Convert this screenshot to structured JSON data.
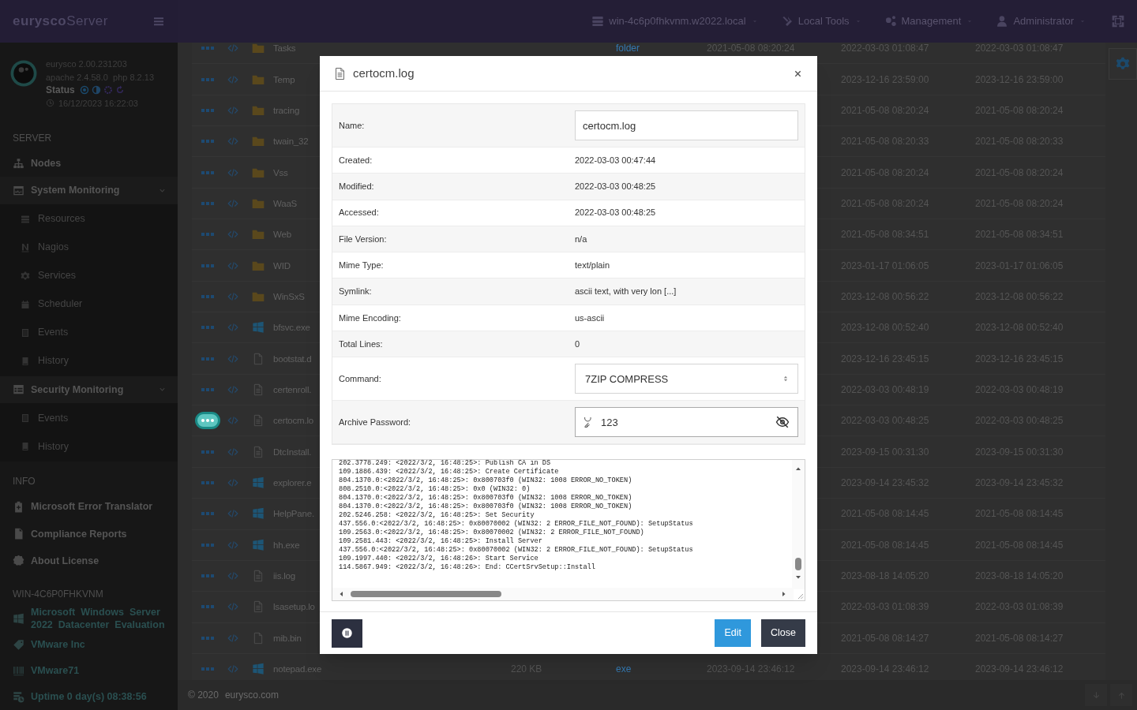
{
  "topbar": {
    "brand_bold": "eurysco",
    "brand_light": "Server",
    "menus": [
      {
        "label": "win-4c6p0fhkvnm.w2022.local"
      },
      {
        "label": "Local Tools"
      },
      {
        "label": "Management"
      },
      {
        "label": "Administrator"
      }
    ]
  },
  "sidebar": {
    "profile": {
      "version": "eurysco 2.00.231203",
      "stack": "apache 2.4.58.0  php 8.2.13",
      "status_label": "Status",
      "datetime": "16/12/2023 16:22:03"
    },
    "sections": [
      {
        "heading": "SERVER",
        "items": [
          {
            "label": "Nodes",
            "kind": "link"
          },
          {
            "label": "System Monitoring",
            "kind": "group",
            "expanded": true,
            "children": [
              {
                "label": "Resources"
              },
              {
                "label": "Nagios"
              },
              {
                "label": "Services"
              },
              {
                "label": "Scheduler"
              },
              {
                "label": "Events"
              },
              {
                "label": "History"
              }
            ]
          },
          {
            "label": "Security Monitoring",
            "kind": "group",
            "expanded": true,
            "children": [
              {
                "label": "Events"
              },
              {
                "label": "History"
              }
            ]
          }
        ]
      },
      {
        "heading": "INFO",
        "items": [
          {
            "label": "Microsoft Error Translator",
            "kind": "link"
          },
          {
            "label": "Compliance Reports",
            "kind": "link"
          },
          {
            "label": "About License",
            "kind": "link"
          }
        ]
      },
      {
        "heading": "WIN-4C6P0FHKVNM",
        "items": [
          {
            "label": "Microsoft  Windows  Server  2022  Datacenter  Evaluation",
            "kind": "info"
          },
          {
            "label": "VMware Inc",
            "kind": "info"
          },
          {
            "label": "VMware71",
            "kind": "info"
          },
          {
            "label": "Uptime 0 day(s) 08:38:56",
            "kind": "info"
          }
        ]
      }
    ]
  },
  "files": [
    {
      "name": "Tasks",
      "kind": "dir",
      "selected": false,
      "type": "folder",
      "created": "2021-05-08 08:20:24",
      "modified": "2022-03-03 01:08:47",
      "accessed": "2022-03-03 01:08:47"
    },
    {
      "name": "Temp",
      "kind": "dir",
      "selected": false,
      "modified": "2023-12-16 23:59:00",
      "accessed": "2023-12-16 23:59:00"
    },
    {
      "name": "tracing",
      "kind": "dir",
      "selected": false,
      "modified": "2021-05-08 08:20:24",
      "accessed": "2021-05-08 08:20:24"
    },
    {
      "name": "twain_32",
      "kind": "dir",
      "selected": false,
      "modified": "2021-05-08 08:20:33",
      "accessed": "2021-05-08 08:20:33"
    },
    {
      "name": "Vss",
      "kind": "dir",
      "selected": false,
      "modified": "2021-05-08 08:20:24",
      "accessed": "2021-05-08 08:20:24"
    },
    {
      "name": "WaaS",
      "kind": "dir",
      "selected": false,
      "modified": "2021-05-08 08:20:24",
      "accessed": "2021-05-08 08:20:24"
    },
    {
      "name": "Web",
      "kind": "dir",
      "selected": false,
      "modified": "2021-05-08 08:34:51",
      "accessed": "2021-05-08 08:34:51"
    },
    {
      "name": "WID",
      "kind": "dir",
      "selected": false,
      "modified": "2023-01-17 01:06:05",
      "accessed": "2023-01-17 01:06:05"
    },
    {
      "name": "WinSxS",
      "kind": "dir",
      "selected": false,
      "modified": "2023-12-08 00:56:22",
      "accessed": "2023-12-08 00:56:22"
    },
    {
      "name": "bfsvc.exe",
      "kind": "win",
      "selected": false,
      "modified": "2023-12-08 00:52:40",
      "accessed": "2023-12-08 00:52:40"
    },
    {
      "name": "bootstat.d",
      "kind": "plain",
      "selected": false,
      "modified": "2023-12-16 23:45:15",
      "accessed": "2023-12-16 23:45:15"
    },
    {
      "name": "certenroll.",
      "kind": "lines",
      "selected": false,
      "modified": "2022-03-03 00:48:19",
      "accessed": "2022-03-03 00:48:19"
    },
    {
      "name": "certocm.lo",
      "kind": "lines",
      "selected": true,
      "modified": "2022-03-03 00:48:25",
      "accessed": "2022-03-03 00:48:25"
    },
    {
      "name": "DtcInstall.",
      "kind": "lines",
      "selected": false,
      "modified": "2023-09-15 00:31:30",
      "accessed": "2023-09-15 00:31:30"
    },
    {
      "name": "explorer.e",
      "kind": "win",
      "selected": false,
      "modified": "2023-09-14 23:45:32",
      "accessed": "2023-09-14 23:45:32"
    },
    {
      "name": "HelpPane.",
      "kind": "win",
      "selected": false,
      "modified": "2021-05-08 08:14:45",
      "accessed": "2021-05-08 08:14:45"
    },
    {
      "name": "hh.exe",
      "kind": "win",
      "selected": false,
      "modified": "2021-05-08 08:14:45",
      "accessed": "2021-05-08 08:14:45"
    },
    {
      "name": "iis.log",
      "kind": "lines",
      "selected": false,
      "modified": "2023-08-18 14:05:20",
      "accessed": "2023-08-18 14:05:20"
    },
    {
      "name": "lsasetup.lo",
      "kind": "lines",
      "selected": false,
      "modified": "2022-03-03 01:08:39",
      "accessed": "2022-03-03 01:08:39"
    },
    {
      "name": "mib.bin",
      "kind": "plain",
      "selected": false,
      "modified": "2021-05-08 08:14:27",
      "accessed": "2021-05-08 08:14:27"
    },
    {
      "name": "notepad.exe",
      "kind": "win",
      "selected": false,
      "size": "220 KB",
      "type": "exe",
      "created": "2023-09-14 23:46:12",
      "modified": "2023-09-14 23:46:12",
      "accessed": "2023-09-14 23:46:12"
    }
  ],
  "footer": {
    "copyright": "© 2020",
    "site": "eurysco.com"
  },
  "modal": {
    "title": "certocm.log",
    "fields": [
      {
        "label": "Name:",
        "kind": "input",
        "value": "certocm.log"
      },
      {
        "label": "Created:",
        "kind": "text",
        "value": "2022-03-03 00:47:44"
      },
      {
        "label": "Modified:",
        "kind": "text",
        "value": "2022-03-03 00:48:25"
      },
      {
        "label": "Accessed:",
        "kind": "text",
        "value": "2022-03-03 00:48:25"
      },
      {
        "label": "File Version:",
        "kind": "text",
        "value": "n/a"
      },
      {
        "label": "Mime Type:",
        "kind": "text",
        "value": "text/plain"
      },
      {
        "label": "Symlink:",
        "kind": "text",
        "value": "ascii text, with very lon [...]"
      },
      {
        "label": "Mime Encoding:",
        "kind": "text",
        "value": "us-ascii"
      },
      {
        "label": "Total Lines:",
        "kind": "text",
        "value": "0"
      },
      {
        "label": "Command:",
        "kind": "select",
        "value": "7ZIP COMPRESS"
      },
      {
        "label": "Archive Password:",
        "kind": "password",
        "value": "123"
      }
    ],
    "log": [
      "202.3778.249: <2022/3/2, 16:48:25>: Publish CA in DS",
      "109.1886.439: <2022/3/2, 16:48:25>: Create Certificate",
      "804.1370.0:<2022/3/2, 16:48:25>: 0x800703f0 (WIN32: 1008 ERROR_NO_TOKEN)",
      "808.2510.0:<2022/3/2, 16:48:25>: 0x0 (WIN32: 0)",
      "804.1370.0:<2022/3/2, 16:48:25>: 0x800703f0 (WIN32: 1008 ERROR_NO_TOKEN)",
      "804.1370.0:<2022/3/2, 16:48:25>: 0x800703f0 (WIN32: 1008 ERROR_NO_TOKEN)",
      "202.5246.258: <2022/3/2, 16:48:25>: Set Security",
      "437.556.0:<2022/3/2, 16:48:25>: 0x80070002 (WIN32: 2 ERROR_FILE_NOT_FOUND): SetupStatus",
      "109.2563.0:<2022/3/2, 16:48:25>: 0x80070002 (WIN32: 2 ERROR_FILE_NOT_FOUND)",
      "109.2581.443: <2022/3/2, 16:48:25>: Install Server",
      "437.556.0:<2022/3/2, 16:48:25>: 0x80070002 (WIN32: 2 ERROR_FILE_NOT_FOUND): SetupStatus",
      "109.1997.440: <2022/3/2, 16:48:26>: Start Service",
      "114.5867.949: <2022/3/2, 16:48:26>: End: CCertSrvSetup::Install"
    ],
    "buttons": [
      {
        "label": "Edit",
        "kind": "primary"
      },
      {
        "label": "Close",
        "kind": "dark"
      }
    ]
  }
}
